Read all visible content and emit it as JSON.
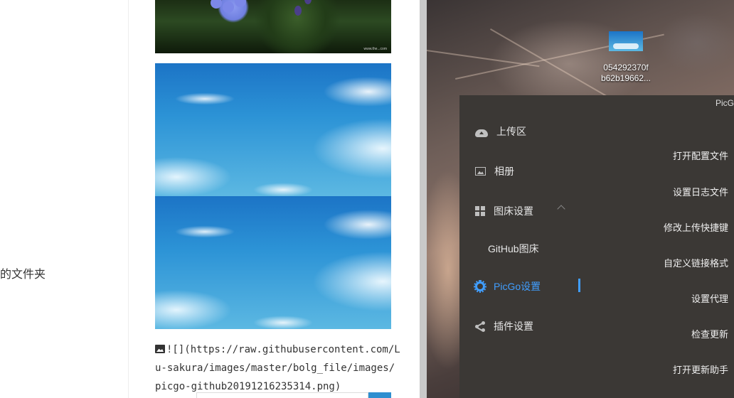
{
  "editor": {
    "outline_fragment": "的文件夹",
    "flower_watermark": "www.the...com",
    "markdown_link": "![](https://raw.githubusercontent.com/Lu-sakura/images/master/bolg_file/images/picgo-github20191216235314.png)"
  },
  "desktop": {
    "file_icon_name": "054292370f b62b19662...",
    "icon": "image-file-icon"
  },
  "picgo": {
    "window_title": "PicG",
    "nav": [
      {
        "label": "上传区",
        "icon": "cloud-upload-icon"
      },
      {
        "label": "相册",
        "icon": "image-icon"
      },
      {
        "label": "图床设置",
        "icon": "grid-icon"
      },
      {
        "label": "GitHub图床"
      },
      {
        "label": "PicGo设置",
        "icon": "gear-icon",
        "active": true
      },
      {
        "label": "插件设置",
        "icon": "share-icon"
      }
    ],
    "settings": [
      "打开配置文件",
      "设置日志文件",
      "修改上传快捷键",
      "自定义链接格式",
      "设置代理",
      "检查更新",
      "打开更新助手"
    ],
    "accent_color": "#409eff"
  }
}
